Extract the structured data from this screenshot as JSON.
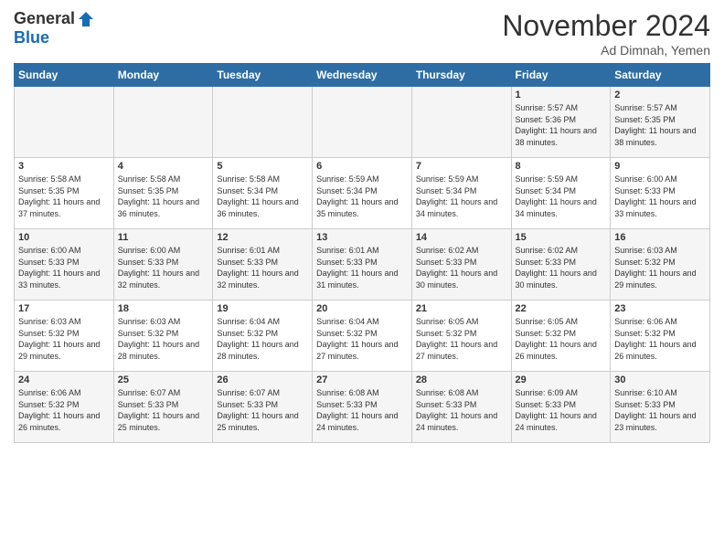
{
  "header": {
    "logo_general": "General",
    "logo_blue": "Blue",
    "month_year": "November 2024",
    "location": "Ad Dimnah, Yemen"
  },
  "days_of_week": [
    "Sunday",
    "Monday",
    "Tuesday",
    "Wednesday",
    "Thursday",
    "Friday",
    "Saturday"
  ],
  "weeks": [
    [
      {
        "day": "",
        "info": ""
      },
      {
        "day": "",
        "info": ""
      },
      {
        "day": "",
        "info": ""
      },
      {
        "day": "",
        "info": ""
      },
      {
        "day": "",
        "info": ""
      },
      {
        "day": "1",
        "info": "Sunrise: 5:57 AM\nSunset: 5:36 PM\nDaylight: 11 hours and 38 minutes."
      },
      {
        "day": "2",
        "info": "Sunrise: 5:57 AM\nSunset: 5:35 PM\nDaylight: 11 hours and 38 minutes."
      }
    ],
    [
      {
        "day": "3",
        "info": "Sunrise: 5:58 AM\nSunset: 5:35 PM\nDaylight: 11 hours and 37 minutes."
      },
      {
        "day": "4",
        "info": "Sunrise: 5:58 AM\nSunset: 5:35 PM\nDaylight: 11 hours and 36 minutes."
      },
      {
        "day": "5",
        "info": "Sunrise: 5:58 AM\nSunset: 5:34 PM\nDaylight: 11 hours and 36 minutes."
      },
      {
        "day": "6",
        "info": "Sunrise: 5:59 AM\nSunset: 5:34 PM\nDaylight: 11 hours and 35 minutes."
      },
      {
        "day": "7",
        "info": "Sunrise: 5:59 AM\nSunset: 5:34 PM\nDaylight: 11 hours and 34 minutes."
      },
      {
        "day": "8",
        "info": "Sunrise: 5:59 AM\nSunset: 5:34 PM\nDaylight: 11 hours and 34 minutes."
      },
      {
        "day": "9",
        "info": "Sunrise: 6:00 AM\nSunset: 5:33 PM\nDaylight: 11 hours and 33 minutes."
      }
    ],
    [
      {
        "day": "10",
        "info": "Sunrise: 6:00 AM\nSunset: 5:33 PM\nDaylight: 11 hours and 33 minutes."
      },
      {
        "day": "11",
        "info": "Sunrise: 6:00 AM\nSunset: 5:33 PM\nDaylight: 11 hours and 32 minutes."
      },
      {
        "day": "12",
        "info": "Sunrise: 6:01 AM\nSunset: 5:33 PM\nDaylight: 11 hours and 32 minutes."
      },
      {
        "day": "13",
        "info": "Sunrise: 6:01 AM\nSunset: 5:33 PM\nDaylight: 11 hours and 31 minutes."
      },
      {
        "day": "14",
        "info": "Sunrise: 6:02 AM\nSunset: 5:33 PM\nDaylight: 11 hours and 30 minutes."
      },
      {
        "day": "15",
        "info": "Sunrise: 6:02 AM\nSunset: 5:33 PM\nDaylight: 11 hours and 30 minutes."
      },
      {
        "day": "16",
        "info": "Sunrise: 6:03 AM\nSunset: 5:32 PM\nDaylight: 11 hours and 29 minutes."
      }
    ],
    [
      {
        "day": "17",
        "info": "Sunrise: 6:03 AM\nSunset: 5:32 PM\nDaylight: 11 hours and 29 minutes."
      },
      {
        "day": "18",
        "info": "Sunrise: 6:03 AM\nSunset: 5:32 PM\nDaylight: 11 hours and 28 minutes."
      },
      {
        "day": "19",
        "info": "Sunrise: 6:04 AM\nSunset: 5:32 PM\nDaylight: 11 hours and 28 minutes."
      },
      {
        "day": "20",
        "info": "Sunrise: 6:04 AM\nSunset: 5:32 PM\nDaylight: 11 hours and 27 minutes."
      },
      {
        "day": "21",
        "info": "Sunrise: 6:05 AM\nSunset: 5:32 PM\nDaylight: 11 hours and 27 minutes."
      },
      {
        "day": "22",
        "info": "Sunrise: 6:05 AM\nSunset: 5:32 PM\nDaylight: 11 hours and 26 minutes."
      },
      {
        "day": "23",
        "info": "Sunrise: 6:06 AM\nSunset: 5:32 PM\nDaylight: 11 hours and 26 minutes."
      }
    ],
    [
      {
        "day": "24",
        "info": "Sunrise: 6:06 AM\nSunset: 5:32 PM\nDaylight: 11 hours and 26 minutes."
      },
      {
        "day": "25",
        "info": "Sunrise: 6:07 AM\nSunset: 5:33 PM\nDaylight: 11 hours and 25 minutes."
      },
      {
        "day": "26",
        "info": "Sunrise: 6:07 AM\nSunset: 5:33 PM\nDaylight: 11 hours and 25 minutes."
      },
      {
        "day": "27",
        "info": "Sunrise: 6:08 AM\nSunset: 5:33 PM\nDaylight: 11 hours and 24 minutes."
      },
      {
        "day": "28",
        "info": "Sunrise: 6:08 AM\nSunset: 5:33 PM\nDaylight: 11 hours and 24 minutes."
      },
      {
        "day": "29",
        "info": "Sunrise: 6:09 AM\nSunset: 5:33 PM\nDaylight: 11 hours and 24 minutes."
      },
      {
        "day": "30",
        "info": "Sunrise: 6:10 AM\nSunset: 5:33 PM\nDaylight: 11 hours and 23 minutes."
      }
    ]
  ]
}
